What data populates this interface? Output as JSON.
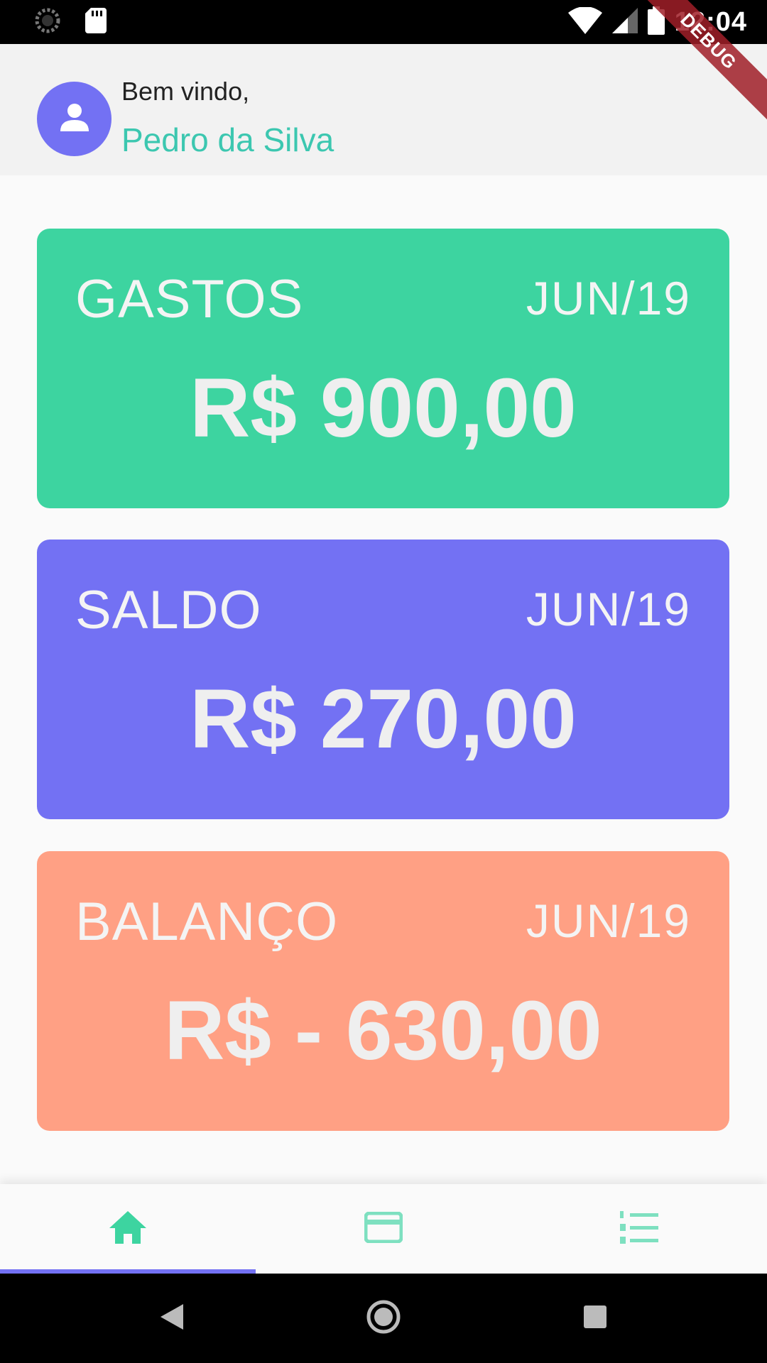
{
  "status_bar": {
    "time": "12:04",
    "icons": [
      "loading-icon",
      "sd-card-icon",
      "wifi-icon",
      "signal-icon",
      "battery-icon"
    ]
  },
  "debug_banner": "DEBUG",
  "header": {
    "greeting": "Bem vindo,",
    "user_name": "Pedro da Silva",
    "avatar_icon": "person-icon"
  },
  "cards": [
    {
      "title": "GASTOS",
      "period": "JUN/19",
      "amount": "R$ 900,00",
      "color": "#3dd4a0"
    },
    {
      "title": "SALDO",
      "period": "JUN/19",
      "amount": "R$ 270,00",
      "color": "#7371f3"
    },
    {
      "title": "BALANÇO",
      "period": "JUN/19",
      "amount": "R$ - 630,00",
      "color": "#ffa084"
    }
  ],
  "bottom_nav": {
    "items": [
      {
        "icon": "home-icon",
        "selected": true
      },
      {
        "icon": "credit-card-icon",
        "selected": false
      },
      {
        "icon": "numbered-list-icon",
        "selected": false
      }
    ],
    "active_color": "#3dd4a0",
    "indicator_color": "#7371f3"
  },
  "system_nav": [
    "back-icon",
    "home-circle-icon",
    "recents-icon"
  ],
  "colors": {
    "accent": "#3cc7b0",
    "primary": "#7371f3"
  }
}
